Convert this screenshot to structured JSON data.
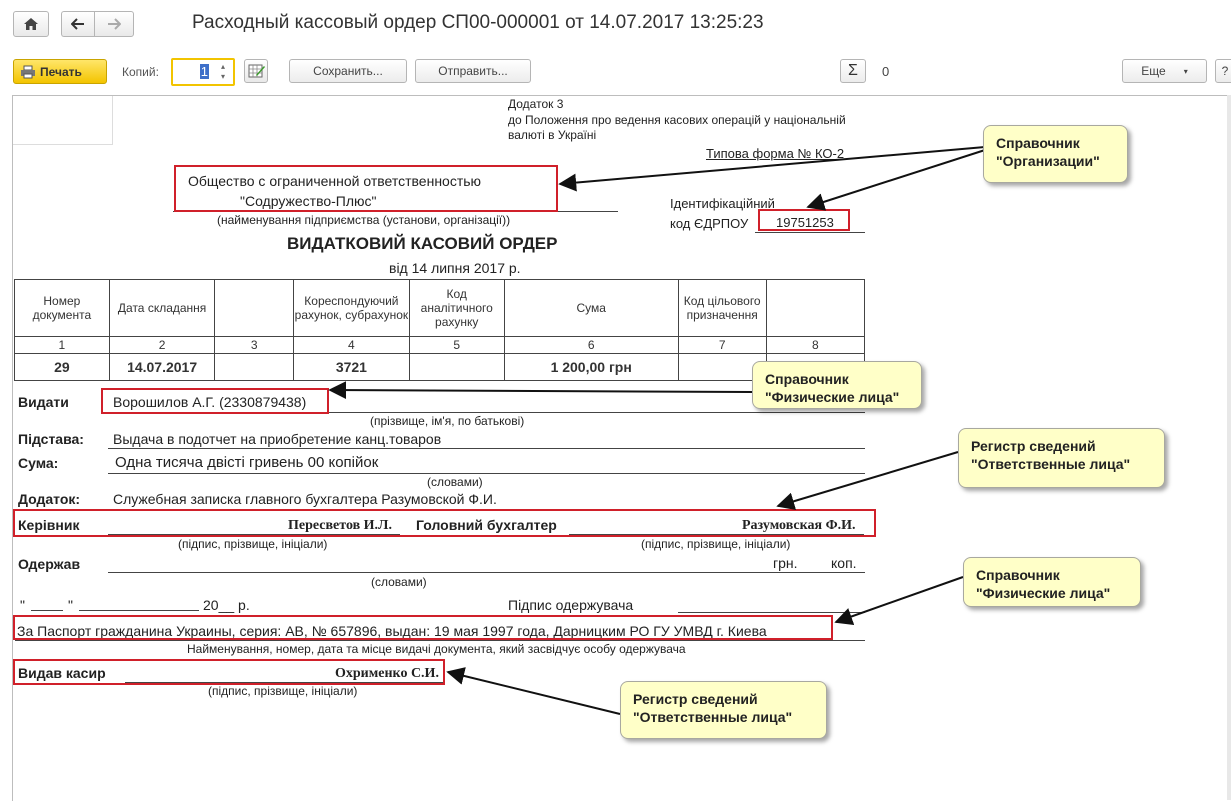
{
  "window": {
    "title": "Расходный кассовый ордер СП00-000001 от 14.07.2017 13:25:23"
  },
  "toolbar": {
    "print_label": "Печать",
    "copies_label": "Копий:",
    "copies_value": "1",
    "save_label": "Сохранить...",
    "send_label": "Отправить...",
    "sum_value": "0",
    "more_label": "Еще",
    "help_label": "?"
  },
  "document": {
    "appendix": [
      "Додаток 3",
      "до Положення про ведення касових операцій у національній",
      "валюті в Україні"
    ],
    "typical_form": "Типова форма  № КО-2",
    "org_line1": "Общество с ограниченной ответственностью",
    "org_line2": "\"Содружество-Плюс\"",
    "org_caption": "(найменування підприємства (установи, організації))",
    "id_label1": "Ідентифікаційний",
    "id_label2": "код ЄДРПОУ",
    "edrpou": "19751253",
    "heading": "ВИДАТКОВИЙ КАСОВИЙ ОРДЕР",
    "date_line": "від  14 липня 2017 р.",
    "table": {
      "headers": [
        "Номер документа",
        "Дата складання",
        "",
        "Кореспондуючий рахунок, субрахунок",
        "Код аналітичного рахунку",
        "Сума",
        "Код цільового призначення",
        ""
      ],
      "numbers": [
        "1",
        "2",
        "3",
        "4",
        "5",
        "6",
        "7",
        "8"
      ],
      "values": [
        "29",
        "14.07.2017",
        "",
        "3721",
        "",
        "1 200,00 грн",
        "",
        ""
      ]
    },
    "issue_label": "Видати",
    "issue_value": "Ворошилов А.Г. (2330879438)",
    "issue_caption": "(прізвище, ім'я, по батькові)",
    "basis_label": "Підстава:",
    "basis_value": "Выдача в подотчет на приобретение канц.товаров",
    "sum_label": "Сума:",
    "sum_value": "Одна тисяча двісті гривень 00 копійок",
    "sum_caption": "(словами)",
    "attach_label": "Додаток:",
    "attach_value": "Служебная записка главного бухгалтера Разумовской Ф.И.",
    "head_label": "Керівник",
    "head_value": "Пересветов И.Л.",
    "chief_acc_label": "Головний бухгалтер",
    "chief_acc_value": "Разумовская Ф.И.",
    "sign_caption": "(підпис, прізвище, ініціали)",
    "received_label": "Одержав",
    "grn_label": "грн.",
    "kop_label": "коп.",
    "words_caption": "(словами)",
    "date_quote_open": "\"",
    "date_quote_close": "\"",
    "year_label": "20__ р.",
    "recipient_sign": "Підпис одержувача",
    "passport_value": "За Паспорт гражданина Украины, серия: АВ, № 657896, выдан: 19 мая 1997 года, Дарницким РО ГУ УМВД г. Киева",
    "passport_caption": "Найменування, номер, дата та місце видачі документа, який засвідчує особу одержувача",
    "cashier_label": "Видав касир",
    "cashier_value": "Охрименко С.И.",
    "cashier_caption": "(підпис, прізвище, ініціали)"
  },
  "callouts": {
    "org": [
      "Справочник",
      "\"Организации\""
    ],
    "person1": [
      "Справочник",
      "\"Физические лица\""
    ],
    "resp1": [
      "Регистр сведений",
      "\"Ответственные лица\""
    ],
    "person2": [
      "Справочник",
      "\"Физические лица\""
    ],
    "resp2": [
      "Регистр сведений",
      "\"Ответственные лица\""
    ]
  },
  "colors": {
    "highlight_red": "#d0202a",
    "callout_bg": "#ffffc8",
    "print_button": "#f3c400"
  }
}
